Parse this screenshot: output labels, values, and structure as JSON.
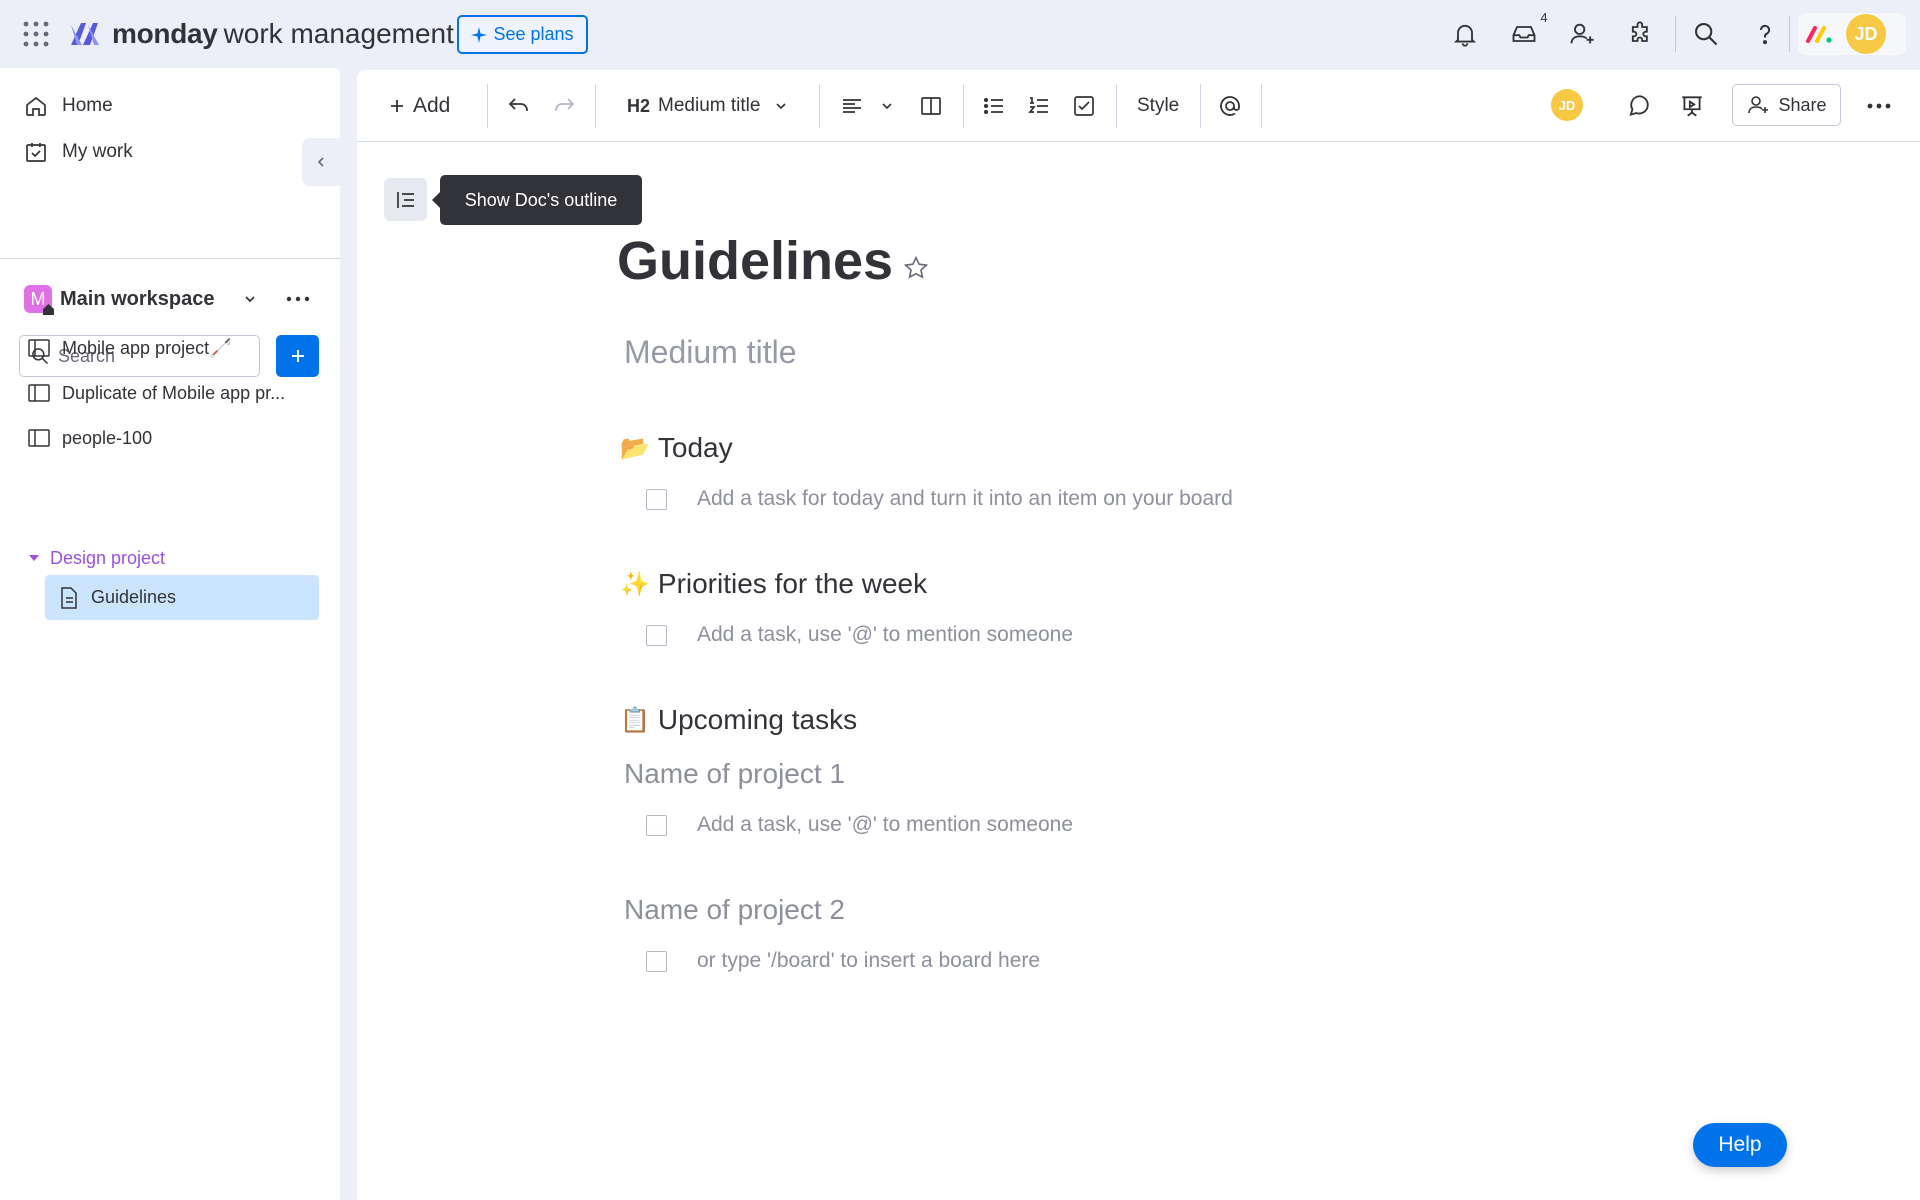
{
  "header": {
    "brand": "monday",
    "brand_sub": "work management",
    "see_plans": "See plans",
    "inbox_count": "4",
    "user_initials": "JD"
  },
  "sidebar": {
    "home": "Home",
    "my_work": "My work",
    "workspace_initial": "M",
    "workspace_name": "Main workspace",
    "search_placeholder": "Search",
    "items": [
      {
        "label": "Mobile app project🦯"
      },
      {
        "label": "Duplicate of Mobile app pr..."
      },
      {
        "label": "people-100"
      }
    ],
    "folder": "Design project",
    "active_item": "Guidelines"
  },
  "toolbar": {
    "add": "Add",
    "heading_style": "Medium title",
    "heading_tag": "H2",
    "style": "Style",
    "user_initials": "JD",
    "share": "Share"
  },
  "tooltip": "Show Doc's outline",
  "doc": {
    "title": "Guidelines",
    "title_placeholder": "Medium title",
    "sections": [
      {
        "emoji": "📂",
        "heading": "Today"
      },
      {
        "emoji": "✨",
        "heading": "Priorities for the week"
      },
      {
        "emoji": "📋",
        "heading": "Upcoming tasks"
      }
    ],
    "tasks": {
      "today": "Add a task for today and turn it into an item on your board",
      "priorities": "Add a task, use '@' to mention someone",
      "project1": "Add a task, use '@' to mention someone",
      "project2": "or type '/board' to insert a board here"
    },
    "projects": [
      "Name of project 1",
      "Name of project 2"
    ]
  },
  "help": "Help",
  "colors": {
    "accent": "#0073ea",
    "avatar": "#f7c843",
    "folder": "#9d50dd",
    "active": "#cce5ff"
  }
}
